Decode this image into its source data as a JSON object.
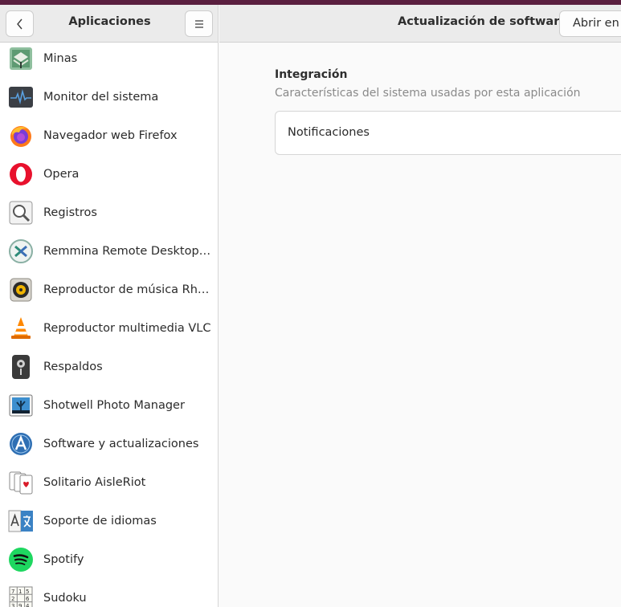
{
  "sidebar": {
    "title": "Aplicaciones",
    "back_icon": "chevron-left-icon",
    "menu_icon": "hamburger-menu-icon",
    "apps": [
      {
        "label": "Minas",
        "icon": "mines-icon"
      },
      {
        "label": "Monitor del sistema",
        "icon": "system-monitor-icon"
      },
      {
        "label": "Navegador web Firefox",
        "icon": "firefox-icon"
      },
      {
        "label": "Opera",
        "icon": "opera-icon"
      },
      {
        "label": "Registros",
        "icon": "logs-icon"
      },
      {
        "label": "Remmina Remote Desktop Cl…",
        "icon": "remmina-icon"
      },
      {
        "label": "Reproductor de música Rhyt…",
        "icon": "rhythmbox-icon"
      },
      {
        "label": "Reproductor multimedia VLC",
        "icon": "vlc-icon"
      },
      {
        "label": "Respaldos",
        "icon": "backups-icon"
      },
      {
        "label": "Shotwell Photo Manager",
        "icon": "shotwell-icon"
      },
      {
        "label": "Software y actualizaciones",
        "icon": "software-updates-icon"
      },
      {
        "label": "Solitario AisleRiot",
        "icon": "solitaire-icon"
      },
      {
        "label": "Soporte de idiomas",
        "icon": "language-support-icon"
      },
      {
        "label": "Spotify",
        "icon": "spotify-icon"
      },
      {
        "label": "Sudoku",
        "icon": "sudoku-icon"
      }
    ]
  },
  "main": {
    "title": "Actualización de software",
    "open_button": "Abrir en Software",
    "section": {
      "title": "Integración",
      "subtitle": "Características del sistema usadas por esta aplicación"
    },
    "rows": [
      {
        "label": "Notificaciones"
      }
    ]
  },
  "colors": {
    "header_bg": "#ebebeb",
    "window_bg": "#fafafa",
    "desktop_bg": "#5a1f3f"
  }
}
